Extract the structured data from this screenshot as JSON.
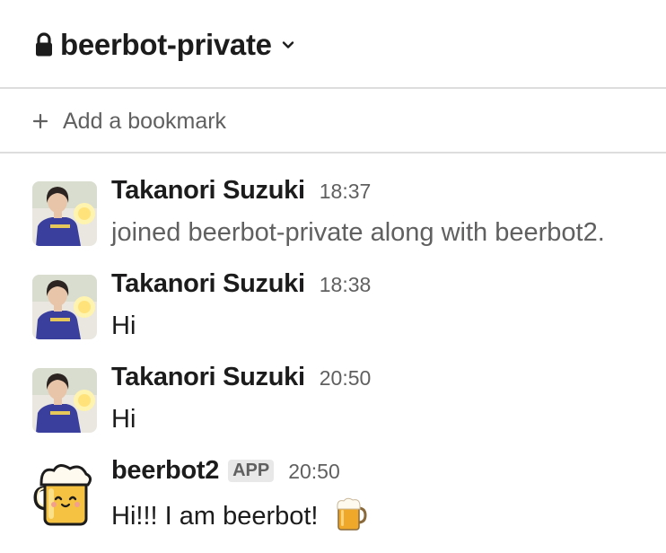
{
  "header": {
    "channel_name": "beerbot-private",
    "icon": "lock-icon",
    "dropdown_icon": "chevron-down-icon"
  },
  "bookmarks": {
    "add_label": "Add a bookmark",
    "icon": "plus-icon"
  },
  "messages": [
    {
      "sender": "Takanori Suzuki",
      "time": "18:37",
      "text": "joined beerbot-private along with beerbot2.",
      "kind": "system",
      "avatar": "user-photo-avatar"
    },
    {
      "sender": "Takanori Suzuki",
      "time": "18:38",
      "text": "Hi",
      "kind": "text",
      "avatar": "user-photo-avatar"
    },
    {
      "sender": "Takanori Suzuki",
      "time": "20:50",
      "text": "Hi",
      "kind": "text",
      "avatar": "user-photo-avatar"
    },
    {
      "sender": "beerbot2",
      "badge": "APP",
      "time": "20:50",
      "text": "Hi!!! I am beerbot!",
      "emoji": "beer-mug-icon",
      "kind": "text",
      "avatar": "beer-mug-avatar"
    }
  ],
  "colors": {
    "text": "#1d1c1d",
    "muted": "#616061",
    "divider": "#dddddd",
    "badge_bg": "#e8e8e8",
    "beer": "#f5c242"
  }
}
